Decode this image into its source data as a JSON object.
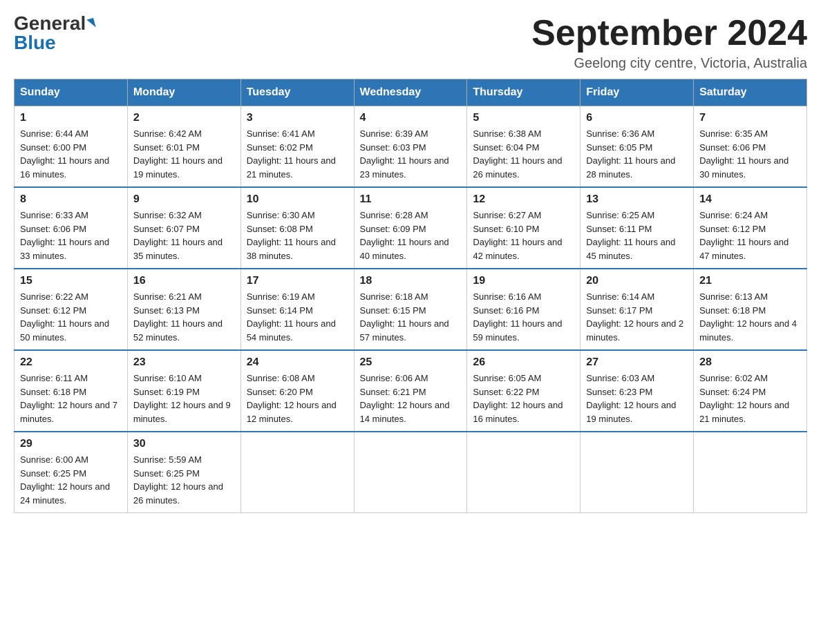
{
  "logo": {
    "general": "General",
    "blue": "Blue"
  },
  "title": "September 2024",
  "location": "Geelong city centre, Victoria, Australia",
  "days_of_week": [
    "Sunday",
    "Monday",
    "Tuesday",
    "Wednesday",
    "Thursday",
    "Friday",
    "Saturday"
  ],
  "weeks": [
    [
      {
        "day": "1",
        "sunrise": "6:44 AM",
        "sunset": "6:00 PM",
        "daylight": "11 hours and 16 minutes."
      },
      {
        "day": "2",
        "sunrise": "6:42 AM",
        "sunset": "6:01 PM",
        "daylight": "11 hours and 19 minutes."
      },
      {
        "day": "3",
        "sunrise": "6:41 AM",
        "sunset": "6:02 PM",
        "daylight": "11 hours and 21 minutes."
      },
      {
        "day": "4",
        "sunrise": "6:39 AM",
        "sunset": "6:03 PM",
        "daylight": "11 hours and 23 minutes."
      },
      {
        "day": "5",
        "sunrise": "6:38 AM",
        "sunset": "6:04 PM",
        "daylight": "11 hours and 26 minutes."
      },
      {
        "day": "6",
        "sunrise": "6:36 AM",
        "sunset": "6:05 PM",
        "daylight": "11 hours and 28 minutes."
      },
      {
        "day": "7",
        "sunrise": "6:35 AM",
        "sunset": "6:06 PM",
        "daylight": "11 hours and 30 minutes."
      }
    ],
    [
      {
        "day": "8",
        "sunrise": "6:33 AM",
        "sunset": "6:06 PM",
        "daylight": "11 hours and 33 minutes."
      },
      {
        "day": "9",
        "sunrise": "6:32 AM",
        "sunset": "6:07 PM",
        "daylight": "11 hours and 35 minutes."
      },
      {
        "day": "10",
        "sunrise": "6:30 AM",
        "sunset": "6:08 PM",
        "daylight": "11 hours and 38 minutes."
      },
      {
        "day": "11",
        "sunrise": "6:28 AM",
        "sunset": "6:09 PM",
        "daylight": "11 hours and 40 minutes."
      },
      {
        "day": "12",
        "sunrise": "6:27 AM",
        "sunset": "6:10 PM",
        "daylight": "11 hours and 42 minutes."
      },
      {
        "day": "13",
        "sunrise": "6:25 AM",
        "sunset": "6:11 PM",
        "daylight": "11 hours and 45 minutes."
      },
      {
        "day": "14",
        "sunrise": "6:24 AM",
        "sunset": "6:12 PM",
        "daylight": "11 hours and 47 minutes."
      }
    ],
    [
      {
        "day": "15",
        "sunrise": "6:22 AM",
        "sunset": "6:12 PM",
        "daylight": "11 hours and 50 minutes."
      },
      {
        "day": "16",
        "sunrise": "6:21 AM",
        "sunset": "6:13 PM",
        "daylight": "11 hours and 52 minutes."
      },
      {
        "day": "17",
        "sunrise": "6:19 AM",
        "sunset": "6:14 PM",
        "daylight": "11 hours and 54 minutes."
      },
      {
        "day": "18",
        "sunrise": "6:18 AM",
        "sunset": "6:15 PM",
        "daylight": "11 hours and 57 minutes."
      },
      {
        "day": "19",
        "sunrise": "6:16 AM",
        "sunset": "6:16 PM",
        "daylight": "11 hours and 59 minutes."
      },
      {
        "day": "20",
        "sunrise": "6:14 AM",
        "sunset": "6:17 PM",
        "daylight": "12 hours and 2 minutes."
      },
      {
        "day": "21",
        "sunrise": "6:13 AM",
        "sunset": "6:18 PM",
        "daylight": "12 hours and 4 minutes."
      }
    ],
    [
      {
        "day": "22",
        "sunrise": "6:11 AM",
        "sunset": "6:18 PM",
        "daylight": "12 hours and 7 minutes."
      },
      {
        "day": "23",
        "sunrise": "6:10 AM",
        "sunset": "6:19 PM",
        "daylight": "12 hours and 9 minutes."
      },
      {
        "day": "24",
        "sunrise": "6:08 AM",
        "sunset": "6:20 PM",
        "daylight": "12 hours and 12 minutes."
      },
      {
        "day": "25",
        "sunrise": "6:06 AM",
        "sunset": "6:21 PM",
        "daylight": "12 hours and 14 minutes."
      },
      {
        "day": "26",
        "sunrise": "6:05 AM",
        "sunset": "6:22 PM",
        "daylight": "12 hours and 16 minutes."
      },
      {
        "day": "27",
        "sunrise": "6:03 AM",
        "sunset": "6:23 PM",
        "daylight": "12 hours and 19 minutes."
      },
      {
        "day": "28",
        "sunrise": "6:02 AM",
        "sunset": "6:24 PM",
        "daylight": "12 hours and 21 minutes."
      }
    ],
    [
      {
        "day": "29",
        "sunrise": "6:00 AM",
        "sunset": "6:25 PM",
        "daylight": "12 hours and 24 minutes."
      },
      {
        "day": "30",
        "sunrise": "5:59 AM",
        "sunset": "6:25 PM",
        "daylight": "12 hours and 26 minutes."
      },
      null,
      null,
      null,
      null,
      null
    ]
  ]
}
